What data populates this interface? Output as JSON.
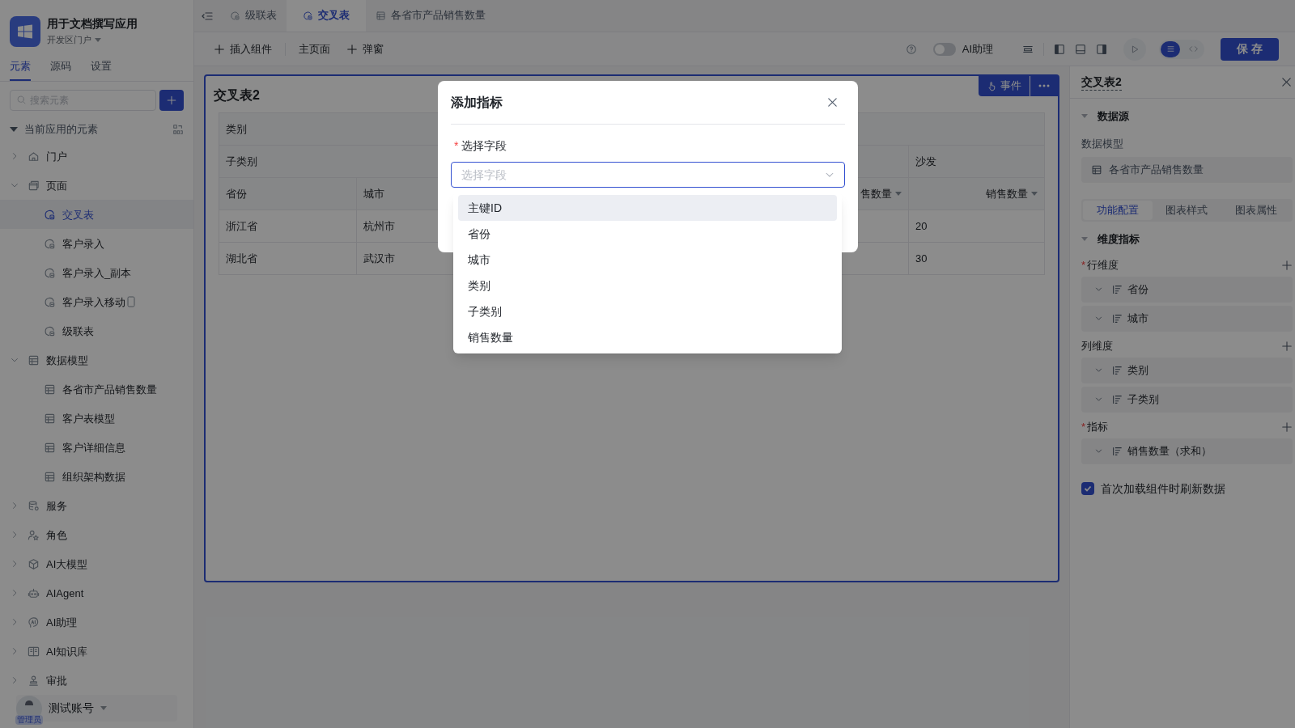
{
  "app": {
    "name": "用于文档撰写应用",
    "portal": "开发区门户"
  },
  "left_tabs": [
    {
      "label": "元素",
      "selected": true
    },
    {
      "label": "源码",
      "selected": false
    },
    {
      "label": "设置",
      "selected": false
    }
  ],
  "search": {
    "placeholder": "搜索元素"
  },
  "tree": {
    "title": "当前应用的元素",
    "items": [
      {
        "label": "门户",
        "kind": "home",
        "expanded": false
      },
      {
        "label": "页面",
        "kind": "page",
        "expanded": true,
        "children": [
          {
            "label": "交叉表",
            "kind": "form",
            "selected": true
          },
          {
            "label": "客户录入",
            "kind": "form",
            "selected": false
          },
          {
            "label": "客户录入_副本",
            "kind": "form",
            "selected": false
          },
          {
            "label": "客户录入移动",
            "kind": "form",
            "selected": false,
            "mobile": true
          },
          {
            "label": "级联表",
            "kind": "form",
            "selected": false
          }
        ]
      },
      {
        "label": "数据模型",
        "kind": "table",
        "expanded": true,
        "children": [
          {
            "label": "各省市产品销售数量",
            "kind": "table",
            "selected": false
          },
          {
            "label": "客户表模型",
            "kind": "table",
            "selected": false
          },
          {
            "label": "客户详细信息",
            "kind": "table",
            "selected": false
          },
          {
            "label": "组织架构数据",
            "kind": "table",
            "selected": false
          }
        ]
      },
      {
        "label": "服务",
        "kind": "service",
        "expanded": false
      },
      {
        "label": "角色",
        "kind": "role",
        "expanded": false
      },
      {
        "label": "AI大模型",
        "kind": "model",
        "expanded": false
      },
      {
        "label": "AIAgent",
        "kind": "agent",
        "expanded": false
      },
      {
        "label": "AI助理",
        "kind": "assistant",
        "expanded": false
      },
      {
        "label": "AI知识库",
        "kind": "knowledge",
        "expanded": false
      },
      {
        "label": "审批",
        "kind": "approval",
        "expanded": false
      }
    ]
  },
  "user": {
    "name": "测试账号",
    "role": "管理员"
  },
  "doc_tabs": [
    {
      "label": "级联表",
      "kind": "form",
      "selected": false
    },
    {
      "label": "交叉表",
      "kind": "form",
      "selected": true
    },
    {
      "label": "各省市产品销售数量",
      "kind": "table",
      "selected": false
    }
  ],
  "toolbar": {
    "view_modes": [
      {
        "kind": "design",
        "selected": true
      },
      {
        "kind": "code",
        "selected": false
      }
    ],
    "items": [
      {
        "label": "插入组件",
        "plus": true
      },
      {
        "label": "主页面",
        "plus": false
      },
      {
        "label": "弹窗",
        "plus": true
      }
    ],
    "ai_assistant": {
      "label": "AI助理",
      "on": false
    },
    "save": "保 存"
  },
  "card": {
    "title": "交叉表2",
    "event_button": "事件"
  },
  "pivot": {
    "header_rows": [
      {
        "label": "类别"
      },
      {
        "label": "子类别",
        "column_4": "沙发"
      }
    ],
    "columns": [
      {
        "label": "省份",
        "sort": false
      },
      {
        "label": "城市",
        "sort": false
      },
      {
        "label": "售数量",
        "sort": true
      },
      {
        "label": "销售数量",
        "sort": true
      }
    ],
    "rows": [
      {
        "province": "浙江省",
        "city": "杭州市",
        "column_4": "20"
      },
      {
        "province": "湖北省",
        "city": "武汉市",
        "column_4": "30"
      }
    ]
  },
  "modal": {
    "title": "添加指标",
    "field_label": "选择字段",
    "required_mark": "*",
    "placeholder": "选择字段",
    "options": [
      {
        "label": "主键ID",
        "highlighted": true
      },
      {
        "label": "省份",
        "highlighted": false
      },
      {
        "label": "城市",
        "highlighted": false
      },
      {
        "label": "类别",
        "highlighted": false
      },
      {
        "label": "子类别",
        "highlighted": false
      },
      {
        "label": "销售数量",
        "highlighted": false
      }
    ]
  },
  "right_panel": {
    "title": "交叉表2",
    "data_source": {
      "title": "数据源",
      "expanded": true,
      "model_label": "数据模型",
      "model": "各省市产品销售数量"
    },
    "sub_tabs": [
      {
        "label": "功能配置",
        "selected": true
      },
      {
        "label": "图表样式",
        "selected": false
      },
      {
        "label": "图表属性",
        "selected": false
      }
    ],
    "dimensions": {
      "title": "维度指标",
      "expanded": true,
      "groups": [
        {
          "label": "行维度",
          "required_mark": "*",
          "fields": [
            "省份",
            "城市"
          ]
        },
        {
          "label": "列维度",
          "fields": [
            "类别",
            "子类别"
          ]
        },
        {
          "label": "指标",
          "required_mark": "*",
          "fields": [
            "销售数量（求和）"
          ]
        }
      ]
    },
    "refresh": {
      "label": "首次加载组件时刷新数据",
      "checked": true
    }
  }
}
